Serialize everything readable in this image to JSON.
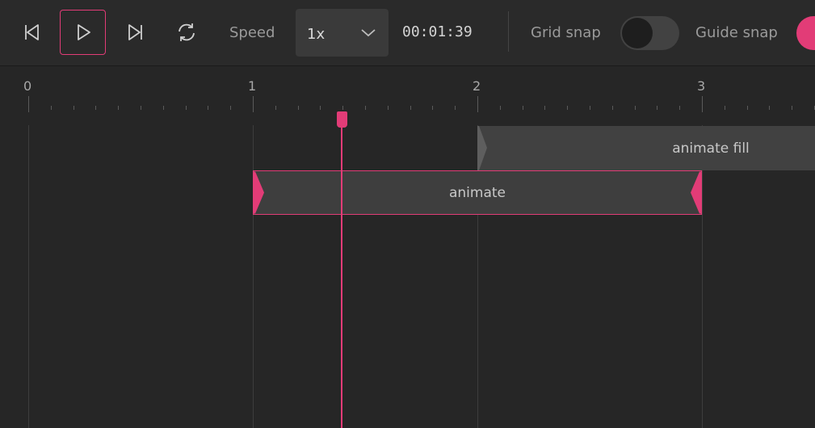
{
  "toolbar": {
    "speed_label": "Speed",
    "speed_value": "1x",
    "time": "00:01:39",
    "grid_snap_label": "Grid snap",
    "grid_snap_on": false,
    "guide_snap_label": "Guide snap",
    "guide_snap_on": true,
    "accent_color": "#e23c77",
    "icons": [
      "skip-back-icon",
      "play-icon",
      "skip-forward-icon",
      "loop-icon",
      "chevron-down-icon"
    ]
  },
  "ruler": {
    "labels": [
      "0",
      "1",
      "2",
      "3"
    ]
  },
  "tracks": [
    {
      "label": "animate fill",
      "start": 2,
      "selected": false
    },
    {
      "label": "animate",
      "start": 1,
      "end": 3,
      "selected": true
    }
  ],
  "playhead": {
    "time_seconds": 1.39
  }
}
